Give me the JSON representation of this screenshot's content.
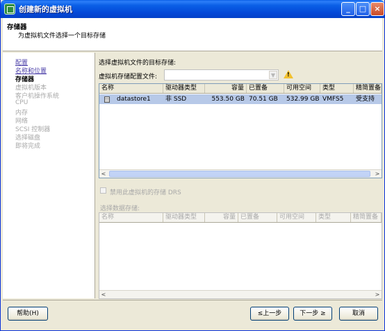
{
  "window": {
    "title": "创建新的虚拟机",
    "min_label": "_",
    "max_label": "□",
    "close_label": "×"
  },
  "header": {
    "title": "存储器",
    "subtitle": "为虚拟机文件选择一个目标存储"
  },
  "nav": {
    "items": [
      {
        "label": "配置",
        "state": "link"
      },
      {
        "label": "名称和位置",
        "state": "link"
      },
      {
        "label": "存储器",
        "state": "active"
      },
      {
        "label": "虚拟机版本",
        "state": "disabled"
      },
      {
        "label": "客户机操作系统",
        "state": "disabled"
      },
      {
        "label": "CPU",
        "state": "disabled"
      },
      {
        "label": "内存",
        "state": "disabled"
      },
      {
        "label": "网络",
        "state": "disabled"
      },
      {
        "label": "SCSI 控制器",
        "state": "disabled"
      },
      {
        "label": "选择磁盘",
        "state": "disabled"
      },
      {
        "label": "即将完成",
        "state": "disabled"
      }
    ]
  },
  "main": {
    "section_title": "选择虚拟机文件的目标存储:",
    "profile_label": "虚拟机存储配置文件:",
    "profile_value": "",
    "warning_icon": "warning-icon",
    "table": {
      "columns": [
        "名称",
        "驱动器类型",
        "容量",
        "已置备",
        "可用空间",
        "类型",
        "精简置备"
      ],
      "rows": [
        {
          "name": "datastore1",
          "drive_type": "非 SSD",
          "capacity": "553.50 GB",
          "provisioned": "70.51 GB",
          "free": "532.99 GB",
          "type": "VMFS5",
          "thin": "受支持"
        }
      ]
    },
    "drs_label": "禁用此虚拟机的存储 DRS",
    "select_datastore_label": "选择数据存储:",
    "table2": {
      "columns": [
        "名称",
        "驱动器类型",
        "容量",
        "已置备",
        "可用空间",
        "类型",
        "精简置备"
      ]
    },
    "scroll_left": "<",
    "scroll_right": ">"
  },
  "buttons": {
    "help": "帮助(H)",
    "back": "≤上一步",
    "next": "下一步 ≥",
    "cancel": "取消"
  },
  "colors": {
    "title_bar": "#0a5fe6",
    "selected_row": "#b7c9e8",
    "link": "#4b3fa8"
  }
}
